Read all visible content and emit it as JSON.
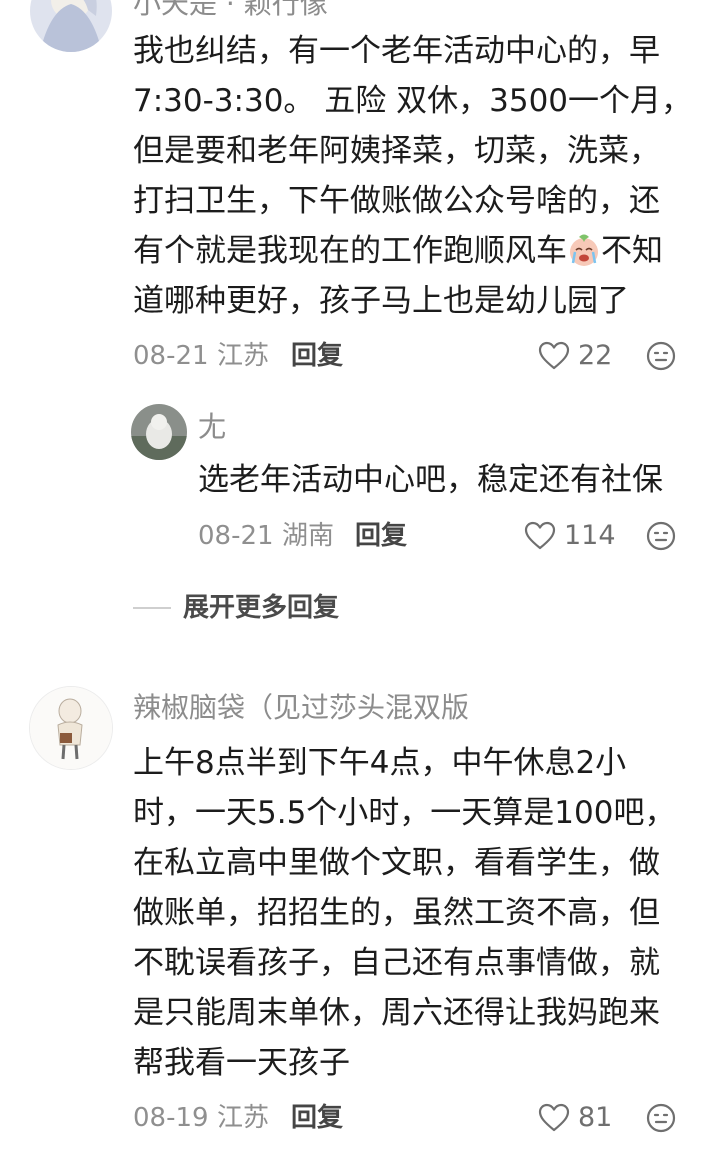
{
  "comments": [
    {
      "username": "小天是 · 颖行像",
      "lines": [
        "我也纠结，有一个老年活动中心的，早",
        "7:30-3:30。  五险 双休，3500一个月，",
        "但是要和老年阿姨择菜，切菜，洗菜，",
        "打扫卫生，下午做账做公众号啥的，还"
      ],
      "line5_before": "有个就是我现在的工作跑顺风车",
      "line5_emoji": "crying-face-emoji",
      "line5_after": "不知",
      "line6": "道哪种更好，孩子马上也是幼儿园了",
      "date": "08-21",
      "location": "江苏",
      "reply_label": "回复",
      "likes": "22"
    },
    {
      "username": "辣椒脑袋（见过莎头混双版",
      "lines": [
        "上午8点半到下午4点，中午休息2小",
        "时，一天5.5个小时，一天算是100吧，",
        "在私立高中里做个文职，看看学生，做",
        "做账单，招招生的，虽然工资不高，但",
        "不耽误看孩子，自己还有点事情做，就",
        "是只能周末单休，周六还得让我妈跑来",
        "帮我看一天孩子"
      ],
      "date": "08-19",
      "location": "江苏",
      "reply_label": "回复",
      "likes": "81"
    }
  ],
  "reply": {
    "username": "尢",
    "text": "选老年活动中心吧，稳定还有社保",
    "date": "08-21",
    "location": "湖南",
    "reply_label": "回复",
    "likes": "114"
  },
  "expand_label": "展开更多回复",
  "icons": {
    "like": "heart-outline-icon",
    "react": "emoji-face-icon"
  },
  "colors": {
    "text": "#1c1c1c",
    "meta": "#8f8f8f",
    "username": "#8c8c8c"
  }
}
